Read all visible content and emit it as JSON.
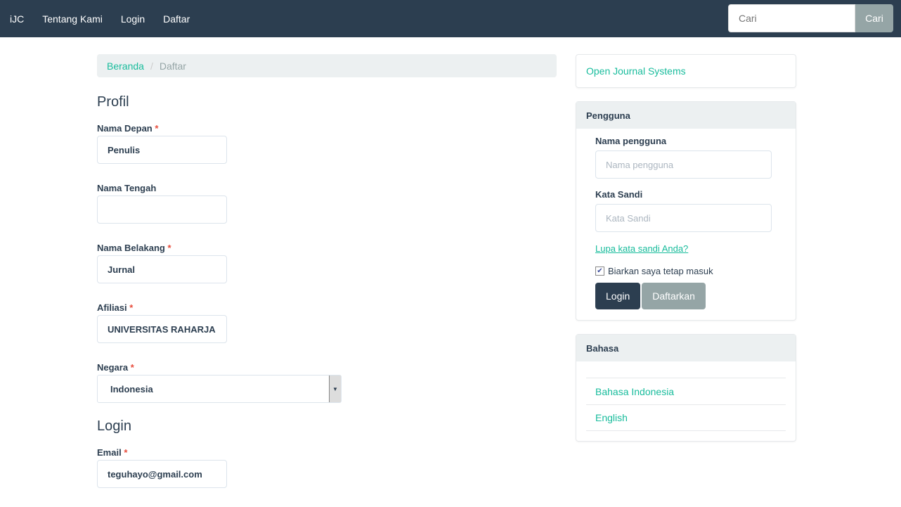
{
  "nav": {
    "brand": "iJC",
    "links": [
      "Tentang Kami",
      "Login",
      "Daftar"
    ],
    "search_placeholder": "Cari",
    "search_button": "Cari"
  },
  "breadcrumb": {
    "home": "Beranda",
    "current": "Daftar"
  },
  "profile": {
    "title": "Profil",
    "first_name_label": "Nama Depan",
    "first_name": "Penulis",
    "middle_name_label": "Nama Tengah",
    "middle_name": "",
    "last_name_label": "Nama Belakang",
    "last_name": "Jurnal",
    "affiliation_label": "Afiliasi",
    "affiliation": "UNIVERSITAS RAHARJA",
    "country_label": "Negara",
    "country": "Indonesia",
    "required_mark": "*"
  },
  "login_section": {
    "title": "Login",
    "email_label": "Email",
    "email": "teguhayo@gmail.com"
  },
  "sidebar": {
    "ojs_link": "Open Journal Systems",
    "user_panel": {
      "title": "Pengguna",
      "username_label": "Nama pengguna",
      "username_placeholder": "Nama pengguna",
      "password_label": "Kata Sandi",
      "password_placeholder": "Kata Sandi",
      "forgot": "Lupa kata sandi Anda?",
      "remember": "Biarkan saya tetap masuk",
      "login": "Login",
      "register": "Daftarkan"
    },
    "language_panel": {
      "title": "Bahasa",
      "languages": [
        "Bahasa Indonesia",
        "English"
      ]
    }
  }
}
